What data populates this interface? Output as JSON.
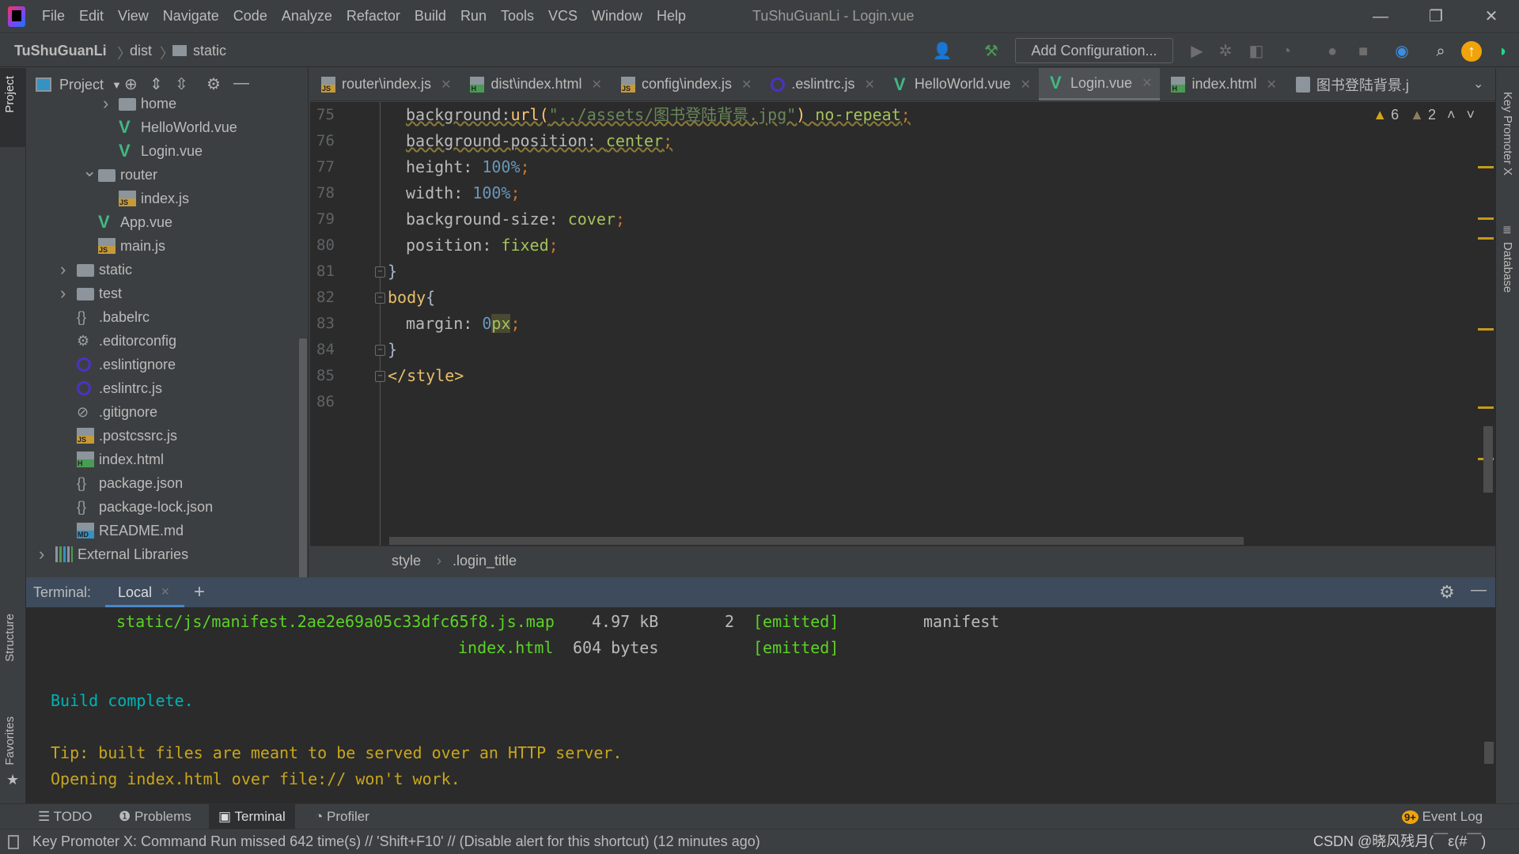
{
  "menubar": {
    "items": [
      "File",
      "Edit",
      "View",
      "Navigate",
      "Code",
      "Analyze",
      "Refactor",
      "Build",
      "Run",
      "Tools",
      "VCS",
      "Window",
      "Help"
    ],
    "title": "TuShuGuanLi - Login.vue"
  },
  "navbar": {
    "crumbs": [
      "TuShuGuanLi",
      "dist",
      "static"
    ],
    "add_config": "Add Configuration..."
  },
  "sidebar": {
    "left_tabs": [
      "Project",
      "Structure",
      "Favorites"
    ],
    "right_tabs": [
      "Key Promoter X",
      "Database"
    ]
  },
  "project": {
    "title": "Project",
    "items": [
      {
        "label": "home",
        "icon": "folder",
        "expand": "collapsed"
      },
      {
        "label": "HelloWorld.vue",
        "icon": "vue"
      },
      {
        "label": "Login.vue",
        "icon": "vue"
      },
      {
        "label": "router",
        "icon": "folder",
        "expand": "expanded"
      },
      {
        "label": "index.js",
        "icon": "js"
      },
      {
        "label": "App.vue",
        "icon": "vue"
      },
      {
        "label": "main.js",
        "icon": "js"
      },
      {
        "label": "static",
        "icon": "folder",
        "expand": "collapsed"
      },
      {
        "label": "test",
        "icon": "folder",
        "expand": "collapsed"
      },
      {
        "label": ".babelrc",
        "icon": "config"
      },
      {
        "label": ".editorconfig",
        "icon": "gear"
      },
      {
        "label": ".eslintignore",
        "icon": "eslint"
      },
      {
        "label": ".eslintrc.js",
        "icon": "eslint"
      },
      {
        "label": ".gitignore",
        "icon": "ignore"
      },
      {
        "label": ".postcssrc.js",
        "icon": "js"
      },
      {
        "label": "index.html",
        "icon": "html"
      },
      {
        "label": "package.json",
        "icon": "config"
      },
      {
        "label": "package-lock.json",
        "icon": "config"
      },
      {
        "label": "README.md",
        "icon": "md"
      },
      {
        "label": "External Libraries",
        "icon": "library",
        "expand": "collapsed"
      }
    ]
  },
  "tabs": [
    {
      "label": "router\\index.js",
      "icon": "js"
    },
    {
      "label": "dist\\index.html",
      "icon": "html"
    },
    {
      "label": "config\\index.js",
      "icon": "js"
    },
    {
      "label": ".eslintrc.js",
      "icon": "eslint"
    },
    {
      "label": "HelloWorld.vue",
      "icon": "vue"
    },
    {
      "label": "Login.vue",
      "icon": "vue",
      "active": true
    },
    {
      "label": "index.html",
      "icon": "html"
    },
    {
      "label": "图书登陆背景.j",
      "icon": "image"
    }
  ],
  "editor": {
    "warnings": "6",
    "weak_warnings": "2",
    "lines": [
      {
        "n": "75",
        "indent": 1,
        "tokens": [
          [
            "prop",
            "background:"
          ],
          [
            "fn",
            "url("
          ],
          [
            "str",
            "\"../assets/图书登陆背景.jpg\""
          ],
          [
            "fn",
            ")"
          ],
          [
            "plain",
            " "
          ],
          [
            "val",
            "no-repeat"
          ],
          [
            "semi",
            ";"
          ]
        ],
        "warn": true
      },
      {
        "n": "76",
        "indent": 1,
        "tokens": [
          [
            "prop",
            "background-position"
          ],
          [
            "prop",
            ": "
          ],
          [
            "val",
            "center"
          ],
          [
            "semi",
            ";"
          ]
        ],
        "warn": true
      },
      {
        "n": "77",
        "indent": 1,
        "tokens": [
          [
            "prop",
            "height: "
          ],
          [
            "num",
            "100%"
          ],
          [
            "semi",
            ";"
          ]
        ]
      },
      {
        "n": "78",
        "indent": 1,
        "tokens": [
          [
            "prop",
            "width: "
          ],
          [
            "num",
            "100%"
          ],
          [
            "semi",
            ";"
          ]
        ]
      },
      {
        "n": "79",
        "indent": 1,
        "tokens": [
          [
            "prop",
            "background-size: "
          ],
          [
            "val",
            "cover"
          ],
          [
            "semi",
            ";"
          ]
        ]
      },
      {
        "n": "80",
        "indent": 1,
        "tokens": [
          [
            "prop",
            "position: "
          ],
          [
            "val",
            "fixed"
          ],
          [
            "semi",
            ";"
          ]
        ]
      },
      {
        "n": "81",
        "indent": 0,
        "tokens": [
          [
            "plain",
            "}"
          ]
        ],
        "fold": true
      },
      {
        "n": "82",
        "indent": 0,
        "tokens": [
          [
            "sel",
            "body"
          ],
          [
            "plain",
            "{"
          ]
        ],
        "fold": true
      },
      {
        "n": "83",
        "indent": 1,
        "tokens": [
          [
            "prop",
            "margin: "
          ],
          [
            "num",
            "0"
          ],
          [
            "hl",
            "px"
          ],
          [
            "semi",
            ";"
          ]
        ]
      },
      {
        "n": "84",
        "indent": 0,
        "tokens": [
          [
            "plain",
            "}"
          ]
        ],
        "fold": true
      },
      {
        "n": "85",
        "indent": 0,
        "tokens": [
          [
            "sel",
            "</style>"
          ]
        ],
        "fold": true
      },
      {
        "n": "86",
        "indent": 0,
        "tokens": []
      }
    ],
    "breadcrumb": [
      "style",
      ".login_title"
    ]
  },
  "terminal": {
    "label": "Terminal:",
    "tab": "Local",
    "row1": {
      "file": "static/js/manifest.2ae2e69a05c33dfc65f8.js.map",
      "size": "4.97 kB",
      "chunks": "2",
      "status": "[emitted]",
      "name": "manifest"
    },
    "row2": {
      "file": "index.html",
      "size": "604 bytes",
      "status": "[emitted]"
    },
    "build": "Build complete.",
    "tip1": "Tip: built files are meant to be served over an HTTP server.",
    "tip2": "Opening index.html over file:// won't work."
  },
  "bottom_tools": {
    "todo": "TODO",
    "problems": "Problems",
    "terminal": "Terminal",
    "profiler": "Profiler",
    "event_log": "Event Log",
    "event_badge": "9+"
  },
  "status": {
    "message": "Key Promoter X: Command Run missed 642 time(s) // 'Shift+F10' // (Disable alert for this shortcut) (12 minutes ago)",
    "watermark": "CSDN @晓风残月(￣ε(#￣)"
  },
  "colors": {
    "editor_bg": "#2b2b2b",
    "panel_bg": "#3c3f41",
    "terminal_header": "#3d4b5c",
    "vue": "#41b883",
    "warning": "#d3a418",
    "terminal_green": "#5bd424",
    "terminal_cyan": "#00b3b3",
    "terminal_yellow": "#c8a61d"
  }
}
